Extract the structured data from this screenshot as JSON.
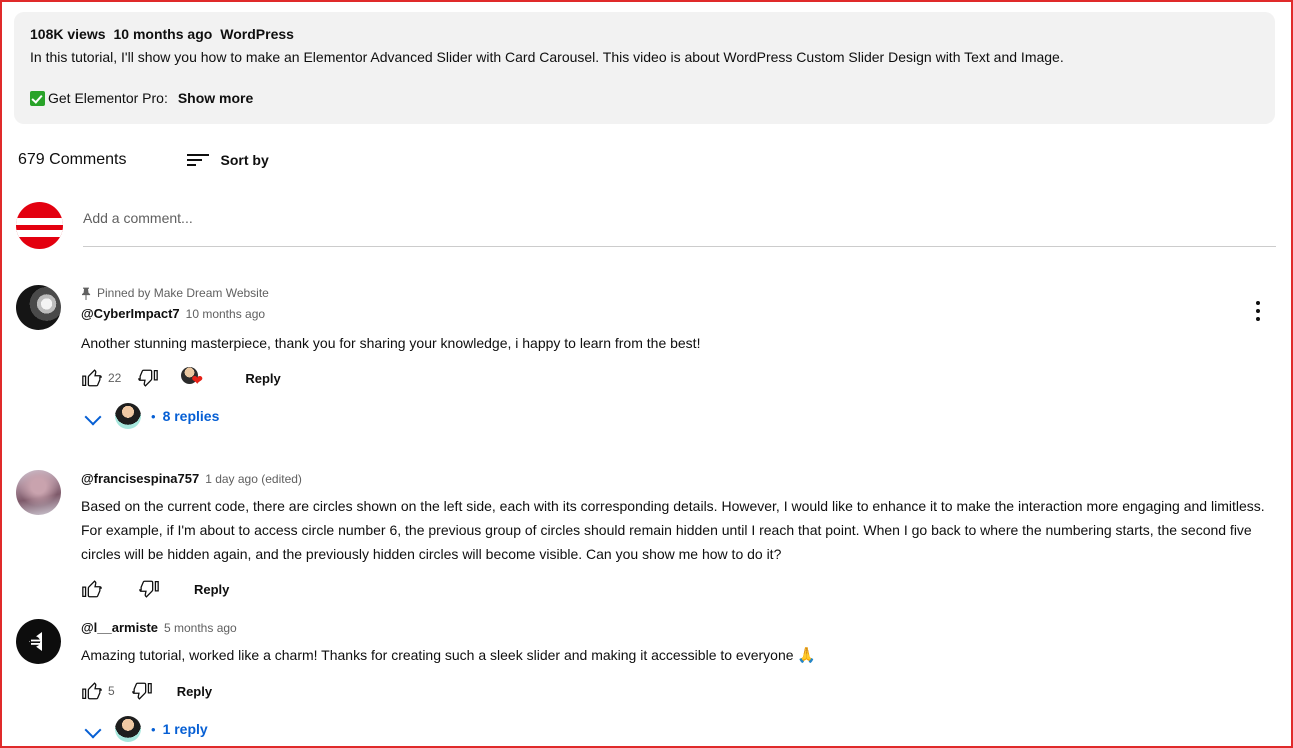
{
  "description": {
    "views": "108K views",
    "age": "10 months ago",
    "tag": "WordPress",
    "text": "In this tutorial, I'll show you how to make an Elementor Advanced Slider with Card Carousel. This video is about WordPress Custom Slider Design with Text and Image.",
    "promo_label": "Get Elementor Pro:",
    "show_more": "Show more",
    "check_icon": "green-check-emoji"
  },
  "comments_header": {
    "count_label": "679 Comments",
    "sort_label": "Sort by",
    "sort_icon": "sort-lines-icon"
  },
  "add_comment": {
    "placeholder": "Add a comment...",
    "avatar": "no-entry-red-avatar"
  },
  "comments": [
    {
      "pinned_text": "Pinned by Make Dream Website",
      "pin_icon": "pin-icon",
      "author": "@CyberImpact7",
      "timestamp": "10 months ago",
      "text": "Another stunning masterpiece, thank you for sharing your knowledge, i happy to learn from the best!",
      "like_count": "22",
      "like_icon": "thumbs-up-icon",
      "dislike_icon": "thumbs-down-icon",
      "creator_heart_icon": "creator-heart-badge",
      "reply_label": "Reply",
      "replies_label": "8 replies",
      "replies_dot": "•",
      "avatar": "dark-face-avatar",
      "kebab_icon": "more-options-icon"
    },
    {
      "author": "@francisespina757",
      "timestamp": "1 day ago (edited)",
      "text": "Based on the current code, there are circles shown on the left side, each with its corresponding details. However, I would like to enhance it to make the interaction more engaging and limitless. For example, if I'm about to access circle number 6, the previous group of circles should remain hidden until I reach that point. When I go back to where the numbering starts, the second five circles will be hidden again, and the previously hidden circles will become visible. Can you show me how to do it?",
      "like_count": "",
      "like_icon": "thumbs-up-icon",
      "dislike_icon": "thumbs-down-icon",
      "reply_label": "Reply",
      "avatar": "portrait-avatar"
    },
    {
      "author": "@l__armiste",
      "timestamp": "5 months ago",
      "text": "Amazing tutorial, worked like a charm! Thanks for creating such a sleek slider and making it accessible to everyone ",
      "emoji": "🙏",
      "like_count": "5",
      "like_icon": "thumbs-up-icon",
      "dislike_icon": "thumbs-down-icon",
      "reply_label": "Reply",
      "replies_label": "1 reply",
      "replies_dot": "•",
      "avatar": "black-logo-avatar"
    }
  ],
  "colors": {
    "link_blue": "#065fd4",
    "accent_red": "#e62117",
    "page_border": "#e02a2a",
    "desc_bg": "#f2f2f2",
    "secondary_text": "#606060"
  }
}
